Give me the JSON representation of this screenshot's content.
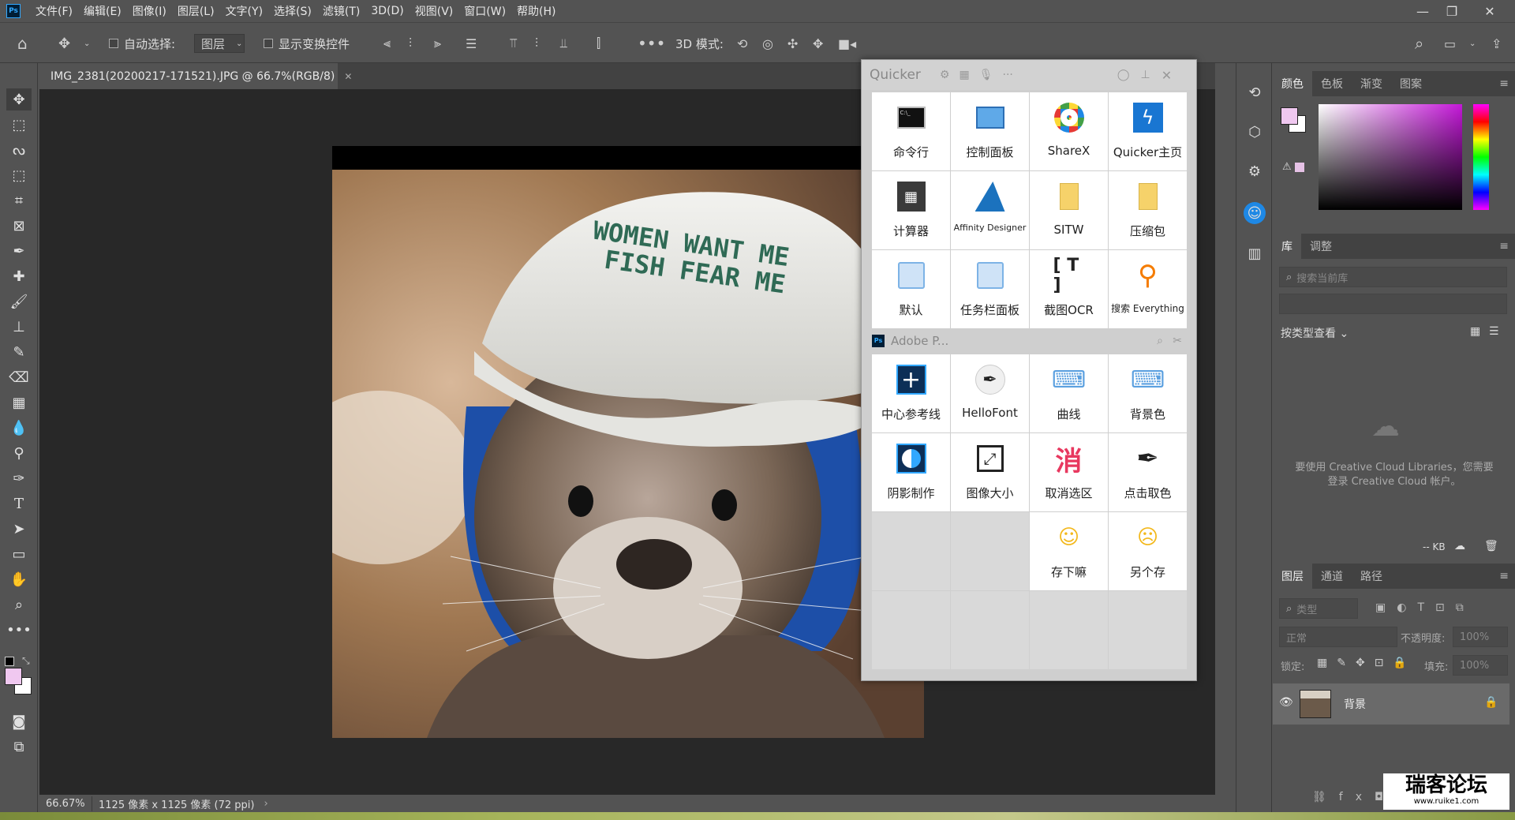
{
  "app": {
    "logo": "Ps"
  },
  "menu": [
    "文件(F)",
    "编辑(E)",
    "图像(I)",
    "图层(L)",
    "文字(Y)",
    "选择(S)",
    "滤镜(T)",
    "3D(D)",
    "视图(V)",
    "窗口(W)",
    "帮助(H)"
  ],
  "options": {
    "auto_select_label": "自动选择:",
    "layer_select": "图层",
    "show_transform_label": "显示变换控件",
    "mode_3d_label": "3D 模式:"
  },
  "document": {
    "tab_title": "IMG_2381(20200217-171521).JPG @ 66.7%(RGB/8)",
    "zoom": "66.67%",
    "dimensions": "1125 像素 x 1125 像素 (72 ppi)"
  },
  "photo": {
    "cap_text_line1": "WOMEN WANT ME",
    "cap_text_line2": "FISH FEAR ME"
  },
  "quicker": {
    "title": "Quicker",
    "row1": [
      {
        "label": "命令行",
        "icon": "terminal-icon"
      },
      {
        "label": "控制面板",
        "icon": "control-panel-icon"
      },
      {
        "label": "ShareX",
        "icon": "sharex-icon"
      },
      {
        "label": "Quicker主页",
        "icon": "quicker-home-icon"
      }
    ],
    "row2": [
      {
        "label": "计算器",
        "icon": "calculator-icon"
      },
      {
        "label": "Affinity Designer",
        "icon": "affinity-designer-icon"
      },
      {
        "label": "SITW",
        "icon": "folder-icon"
      },
      {
        "label": "压缩包",
        "icon": "folder-icon"
      }
    ],
    "row3": [
      {
        "label": "默认",
        "icon": "window-icon"
      },
      {
        "label": "任务栏面板",
        "icon": "window-icon"
      },
      {
        "label": "截图OCR",
        "icon": "ocr-icon"
      },
      {
        "label": "搜索 Everything",
        "icon": "magnifier-icon"
      }
    ],
    "section_title": "Adobe P...",
    "row4": [
      {
        "label": "中心参考线",
        "icon": "crosshair-icon"
      },
      {
        "label": "HelloFont",
        "icon": "pen-nib-icon"
      },
      {
        "label": "曲线",
        "icon": "keyboard-icon"
      },
      {
        "label": "背景色",
        "icon": "keyboard-icon"
      }
    ],
    "row5": [
      {
        "label": "阴影制作",
        "icon": "shadow-icon"
      },
      {
        "label": "图像大小",
        "icon": "resize-icon"
      },
      {
        "label": "取消选区",
        "icon": "cancel-select-icon",
        "glyph": "消"
      },
      {
        "label": "点击取色",
        "icon": "eyedropper-icon"
      }
    ],
    "row6": [
      {
        "label": "存下嘛",
        "icon": "emoji-smile-icon"
      },
      {
        "label": "另个存",
        "icon": "emoji-think-icon"
      }
    ]
  },
  "panels": {
    "color_tabs": [
      "颜色",
      "色板",
      "渐变",
      "图案"
    ],
    "library_tabs": [
      "库",
      "调整"
    ],
    "library_search_placeholder": "搜索当前库",
    "library_view_label": "按类型查看",
    "library_message": "要使用 Creative Cloud Libraries，您需要登录 Creative Cloud 帐户。",
    "library_size": "-- KB",
    "layers_tabs": [
      "图层",
      "通道",
      "路径"
    ],
    "layer_filter": "类型",
    "blend_mode": "正常",
    "opacity_label": "不透明度:",
    "opacity_value": "100%",
    "lock_label": "锁定:",
    "fill_label": "填充:",
    "fill_value": "100%",
    "layer_name": "背景"
  },
  "watermark": {
    "text": "瑞客论坛",
    "url": "www.ruike1.com"
  },
  "colors": {
    "foreground": "#f0c8f0",
    "background": "#ffffff",
    "accent": "#31a8ff"
  }
}
